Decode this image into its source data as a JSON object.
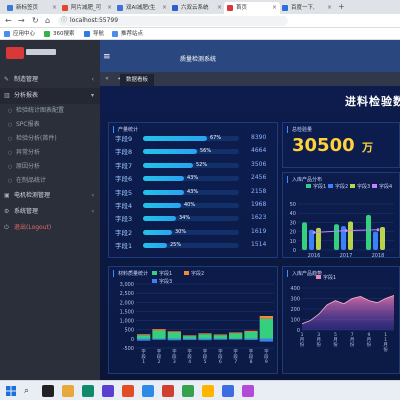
{
  "browser": {
    "tabs": [
      {
        "label": "新标签页",
        "color": "#3a7bd5"
      },
      {
        "label": "阿片减肥_可",
        "color": "#e0482f"
      },
      {
        "label": "双AI减肥(生",
        "color": "#3f6fd8"
      },
      {
        "label": "六双云系统",
        "color": "#2e5fcf"
      },
      {
        "label": "首页",
        "color": "#d93838"
      },
      {
        "label": "百度一下,",
        "color": "#2d6ee0"
      }
    ],
    "active_tab_index": 4,
    "url": "localhost:55799",
    "bookmarks": [
      {
        "label": "应用中心",
        "color": "#4a8df0"
      },
      {
        "label": "360搜索",
        "color": "#35b34a"
      },
      {
        "label": "导航",
        "color": "#2f7ce0"
      },
      {
        "label": "推荐站点",
        "color": "#4a8df0"
      }
    ]
  },
  "app": {
    "title": "质量检测系统",
    "sidebar": [
      {
        "type": "item",
        "icon": "wrench-icon",
        "label": "制造管理",
        "arrow": "‹"
      },
      {
        "type": "item",
        "icon": "chart-icon",
        "label": "分析报表",
        "arrow": "▾",
        "active": true
      },
      {
        "type": "sub",
        "label": "检验统计图表配置"
      },
      {
        "type": "sub",
        "label": "SPC报表"
      },
      {
        "type": "sub",
        "label": "检验分析(首件)"
      },
      {
        "type": "sub",
        "label": "异常分析"
      },
      {
        "type": "sub",
        "label": "原因分析"
      },
      {
        "type": "sub",
        "label": "在制品统计"
      },
      {
        "type": "item",
        "icon": "box-icon",
        "label": "电机检测管理",
        "arrow": "‹"
      },
      {
        "type": "item",
        "icon": "gear-icon",
        "label": "系统管理",
        "arrow": "‹"
      },
      {
        "type": "item",
        "icon": "power-icon",
        "label": "退出(Logout)",
        "arrow": "",
        "logout": true
      }
    ],
    "tabrow": {
      "prev": "«",
      "home": "◀",
      "page_tab": "数据看板"
    }
  },
  "dashboard": {
    "title": "进料检验数",
    "panel_bars_title": "产量统计",
    "panel_total_title": "总检验量",
    "total_value": "30500",
    "total_unit": "万",
    "panel_combo_title": "入库产品分布",
    "panel_stack_title": "材料质量统计",
    "panel_area_title": "入库产品趋势",
    "bars": [
      {
        "label": "字段9",
        "pct": 0.67,
        "pct_text": "67%",
        "value": "8390"
      },
      {
        "label": "字段8",
        "pct": 0.56,
        "pct_text": "56%",
        "value": "4664"
      },
      {
        "label": "字段7",
        "pct": 0.52,
        "pct_text": "52%",
        "value": "3506"
      },
      {
        "label": "字段6",
        "pct": 0.43,
        "pct_text": "43%",
        "value": "2456"
      },
      {
        "label": "字段5",
        "pct": 0.43,
        "pct_text": "43%",
        "value": "2158"
      },
      {
        "label": "字段4",
        "pct": 0.4,
        "pct_text": "40%",
        "value": "1968"
      },
      {
        "label": "字段3",
        "pct": 0.34,
        "pct_text": "34%",
        "value": "1623"
      },
      {
        "label": "字段2",
        "pct": 0.3,
        "pct_text": "30%",
        "value": "1619"
      },
      {
        "label": "字段1",
        "pct": 0.25,
        "pct_text": "25%",
        "value": "1514"
      }
    ],
    "combo_legend": [
      "字段1",
      "字段2",
      "字段3",
      "字段4"
    ],
    "combo_colors": [
      "#35d07f",
      "#3b82f6",
      "#b9d44a",
      "#c084fc"
    ],
    "combo_yticks": [
      "50",
      "40",
      "30",
      "20",
      "10",
      "0"
    ],
    "combo_xticks": [
      "2016",
      "2017",
      "2018"
    ],
    "stack_legend": [
      "字段1",
      "字段2",
      "字段3"
    ],
    "stack_colors": [
      "#35d07f",
      "#f08a3a",
      "#3b82f6"
    ],
    "stack_yticks": [
      "3,000",
      "2,500",
      "2,000",
      "1,500",
      "1,000",
      "500",
      "0",
      "-500"
    ],
    "stack_xticks": [
      "字段1",
      "字段2",
      "字段3",
      "字段4",
      "字段5",
      "字段6",
      "字段7",
      "字段8",
      "字段9"
    ],
    "area_legend": [
      "字段1"
    ],
    "area_yticks": [
      "400",
      "300",
      "200",
      "100",
      "0"
    ],
    "area_xticks": [
      "1月份",
      "3月份",
      "5月份",
      "7月份",
      "9月份",
      "11月份"
    ]
  },
  "chart_data": [
    {
      "type": "bar",
      "title": "产量统计",
      "categories": [
        "字段9",
        "字段8",
        "字段7",
        "字段6",
        "字段5",
        "字段4",
        "字段3",
        "字段2",
        "字段1"
      ],
      "values": [
        8390,
        4664,
        3506,
        2456,
        2158,
        1968,
        1623,
        1619,
        1514
      ],
      "percent": [
        67,
        56,
        52,
        43,
        43,
        40,
        34,
        30,
        25
      ]
    },
    {
      "type": "bar",
      "title": "入库产品分布",
      "categories": [
        "2016",
        "2017",
        "2018"
      ],
      "series": [
        {
          "name": "字段1",
          "values": [
            30,
            28,
            38
          ]
        },
        {
          "name": "字段2",
          "values": [
            22,
            26,
            20
          ]
        },
        {
          "name": "字段3",
          "values": [
            24,
            31,
            25
          ]
        },
        {
          "name": "字段4",
          "values": [
            19,
            21,
            22
          ]
        }
      ],
      "ylim": [
        0,
        50
      ]
    },
    {
      "type": "bar",
      "title": "材料质量统计",
      "categories": [
        "字段1",
        "字段2",
        "字段3",
        "字段4",
        "字段5",
        "字段6",
        "字段7",
        "字段8",
        "字段9"
      ],
      "series": [
        {
          "name": "字段1",
          "values": [
            200,
            450,
            350,
            150,
            250,
            200,
            300,
            380,
            1100
          ]
        },
        {
          "name": "字段2",
          "values": [
            50,
            80,
            60,
            40,
            50,
            40,
            50,
            60,
            150
          ]
        },
        {
          "name": "字段3",
          "values": [
            -100,
            -50,
            -80,
            -60,
            -70,
            -50,
            -40,
            -60,
            -150
          ]
        }
      ],
      "ylim": [
        -500,
        3000
      ]
    },
    {
      "type": "area",
      "title": "入库产品趋势",
      "categories": [
        "1月份",
        "2月份",
        "3月份",
        "4月份",
        "5月份",
        "6月份",
        "7月份",
        "8月份",
        "9月份",
        "10月份",
        "11月份",
        "12月份"
      ],
      "series": [
        {
          "name": "字段1",
          "values": [
            60,
            90,
            150,
            240,
            280,
            250,
            300,
            320,
            280,
            260,
            300,
            330
          ]
        }
      ],
      "ylim": [
        0,
        400
      ]
    }
  ]
}
